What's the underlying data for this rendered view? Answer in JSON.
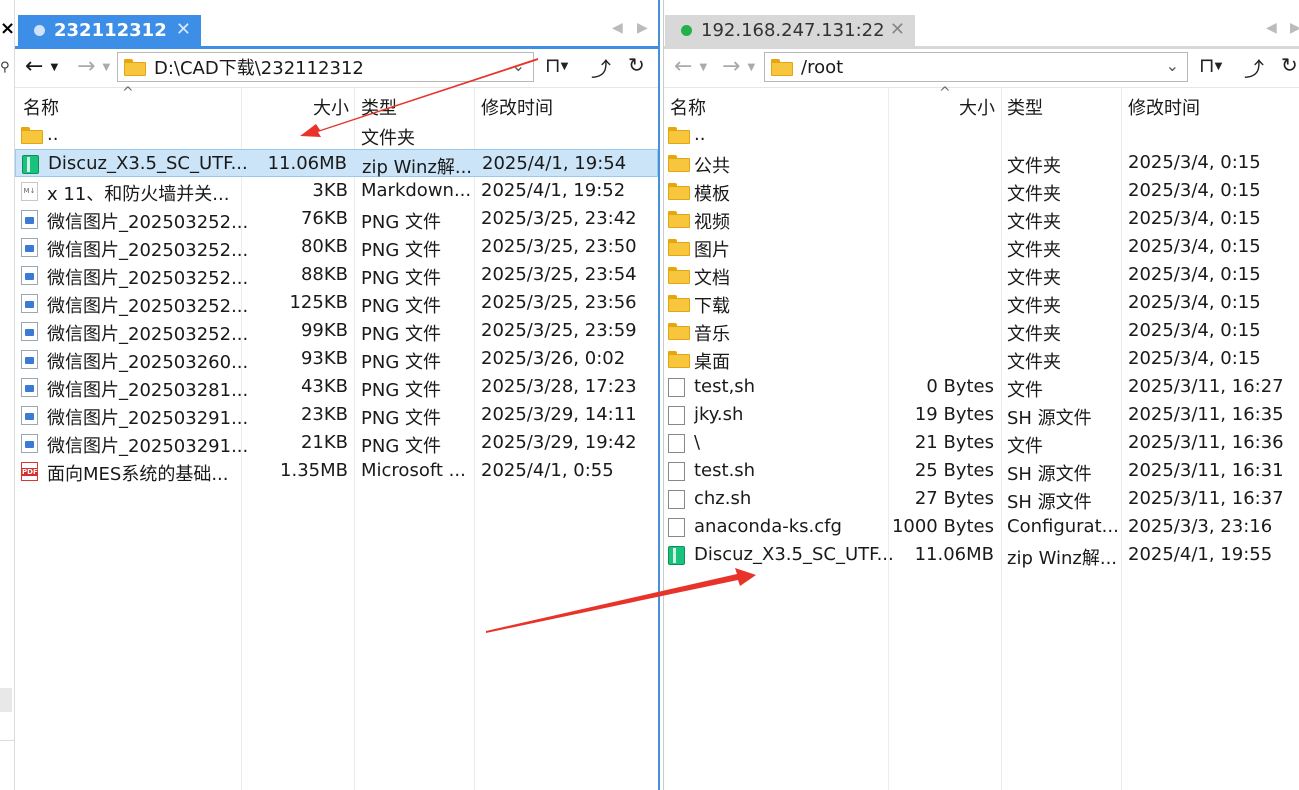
{
  "colors": {
    "accent": "#3d8ee6",
    "selection": "#cce4f7",
    "arrow": "#e8332a",
    "connected": "#21b14b"
  },
  "left_pane": {
    "tab_label": "232112312",
    "address": "D:\\CAD下载\\232112312",
    "columns": {
      "name": "名称",
      "size": "大小",
      "type": "类型",
      "modified": "修改时间"
    },
    "rows": [
      {
        "icon": "folder-icon",
        "name": "..",
        "size": "",
        "type": "文件夹",
        "modified": ""
      },
      {
        "icon": "zip-icon",
        "name": "Discuz_X3.5_SC_UTF...",
        "size": "11.06MB",
        "type": "zip Winz解...",
        "modified": "2025/4/1, 19:54",
        "selected": true
      },
      {
        "icon": "markdown-icon",
        "name": "x 11、和防火墙并关...",
        "size": "3KB",
        "type": "Markdown...",
        "modified": "2025/4/1, 19:52"
      },
      {
        "icon": "image-icon",
        "name": "微信图片_202503252...",
        "size": "76KB",
        "type": "PNG 文件",
        "modified": "2025/3/25, 23:42"
      },
      {
        "icon": "image-icon",
        "name": "微信图片_202503252...",
        "size": "80KB",
        "type": "PNG 文件",
        "modified": "2025/3/25, 23:50"
      },
      {
        "icon": "image-icon",
        "name": "微信图片_202503252...",
        "size": "88KB",
        "type": "PNG 文件",
        "modified": "2025/3/25, 23:54"
      },
      {
        "icon": "image-icon",
        "name": "微信图片_202503252...",
        "size": "125KB",
        "type": "PNG 文件",
        "modified": "2025/3/25, 23:56"
      },
      {
        "icon": "image-icon",
        "name": "微信图片_202503252...",
        "size": "99KB",
        "type": "PNG 文件",
        "modified": "2025/3/25, 23:59"
      },
      {
        "icon": "image-icon",
        "name": "微信图片_202503260...",
        "size": "93KB",
        "type": "PNG 文件",
        "modified": "2025/3/26, 0:02"
      },
      {
        "icon": "image-icon",
        "name": "微信图片_202503281...",
        "size": "43KB",
        "type": "PNG 文件",
        "modified": "2025/3/28, 17:23"
      },
      {
        "icon": "image-icon",
        "name": "微信图片_202503291...",
        "size": "23KB",
        "type": "PNG 文件",
        "modified": "2025/3/29, 14:11"
      },
      {
        "icon": "image-icon",
        "name": "微信图片_202503291...",
        "size": "21KB",
        "type": "PNG 文件",
        "modified": "2025/3/29, 19:42"
      },
      {
        "icon": "pdf-icon",
        "name": "面向MES系统的基础...",
        "size": "1.35MB",
        "type": "Microsoft ...",
        "modified": "2025/4/1, 0:55"
      }
    ]
  },
  "right_pane": {
    "tab_label": "192.168.247.131:22",
    "address": "/root",
    "columns": {
      "name": "名称",
      "size": "大小",
      "type": "类型",
      "modified": "修改时间"
    },
    "rows": [
      {
        "icon": "folder-icon",
        "name": "..",
        "size": "",
        "type": "",
        "modified": ""
      },
      {
        "icon": "folder-icon",
        "name": "公共",
        "size": "",
        "type": "文件夹",
        "modified": "2025/3/4, 0:15"
      },
      {
        "icon": "folder-icon",
        "name": "模板",
        "size": "",
        "type": "文件夹",
        "modified": "2025/3/4, 0:15"
      },
      {
        "icon": "folder-icon",
        "name": "视频",
        "size": "",
        "type": "文件夹",
        "modified": "2025/3/4, 0:15"
      },
      {
        "icon": "folder-icon",
        "name": "图片",
        "size": "",
        "type": "文件夹",
        "modified": "2025/3/4, 0:15"
      },
      {
        "icon": "folder-icon",
        "name": "文档",
        "size": "",
        "type": "文件夹",
        "modified": "2025/3/4, 0:15"
      },
      {
        "icon": "folder-icon",
        "name": "下载",
        "size": "",
        "type": "文件夹",
        "modified": "2025/3/4, 0:15"
      },
      {
        "icon": "folder-icon",
        "name": "音乐",
        "size": "",
        "type": "文件夹",
        "modified": "2025/3/4, 0:15"
      },
      {
        "icon": "folder-icon",
        "name": "桌面",
        "size": "",
        "type": "文件夹",
        "modified": "2025/3/4, 0:15"
      },
      {
        "icon": "file-icon",
        "name": "test,sh",
        "size": "0 Bytes",
        "type": "文件",
        "modified": "2025/3/11, 16:27"
      },
      {
        "icon": "file-icon",
        "name": "jky.sh",
        "size": "19 Bytes",
        "type": "SH 源文件",
        "modified": "2025/3/11, 16:35"
      },
      {
        "icon": "file-icon",
        "name": "\\",
        "size": "21 Bytes",
        "type": "文件",
        "modified": "2025/3/11, 16:36"
      },
      {
        "icon": "file-icon",
        "name": "test.sh",
        "size": "25 Bytes",
        "type": "SH 源文件",
        "modified": "2025/3/11, 16:31"
      },
      {
        "icon": "file-icon",
        "name": "chz.sh",
        "size": "27 Bytes",
        "type": "SH 源文件",
        "modified": "2025/3/11, 16:37"
      },
      {
        "icon": "file-icon",
        "name": "anaconda-ks.cfg",
        "size": "1000 Bytes",
        "type": "Configurat...",
        "modified": "2025/3/3, 23:16"
      },
      {
        "icon": "zip-icon",
        "name": "Discuz_X3.5_SC_UTF...",
        "size": "11.06MB",
        "type": "zip Winz解...",
        "modified": "2025/4/1, 19:55"
      }
    ]
  }
}
